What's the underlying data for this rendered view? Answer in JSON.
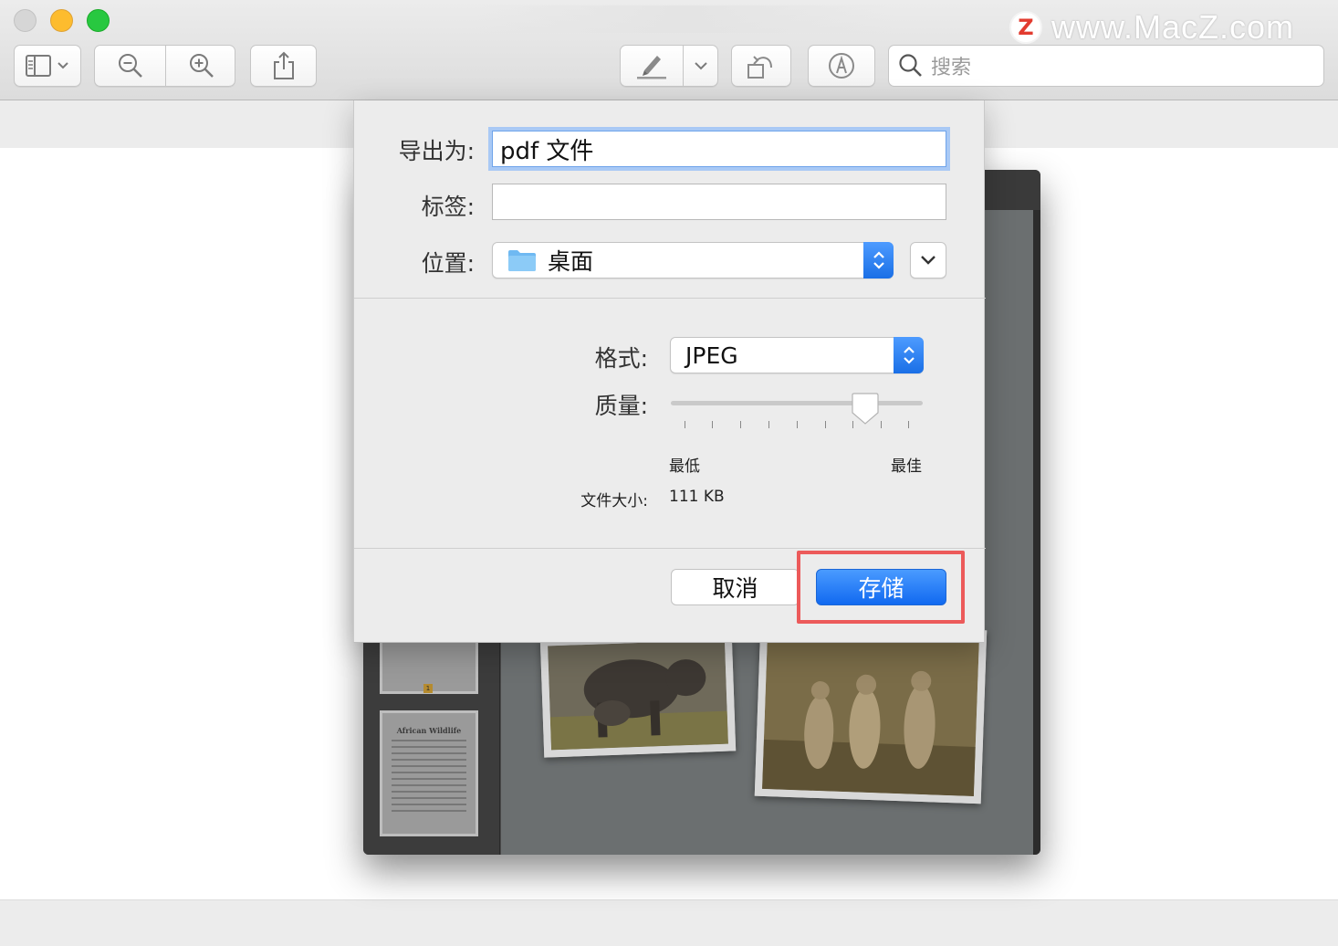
{
  "toolbar": {
    "search_placeholder": "搜索"
  },
  "watermark": {
    "logo_letter": "Z",
    "text": "www.MacZ.com"
  },
  "preview": {
    "thumb_title": "African Wildlife",
    "page_number": "1"
  },
  "save_sheet": {
    "export_as_label": "导出为:",
    "export_as_value": "pdf 文件",
    "tags_label": "标签:",
    "tags_value": "",
    "location_label": "位置:",
    "location_value": "桌面",
    "format_label": "格式:",
    "format_value": "JPEG",
    "quality_label": "质量:",
    "quality_min_label": "最低",
    "quality_max_label": "最佳",
    "quality_level": 0.77,
    "file_size_label": "文件大小:",
    "file_size_value": "111 KB",
    "cancel_label": "取消",
    "save_label": "存储"
  },
  "colors": {
    "accent": "#1a6fe6",
    "highlight": "#ec5a5a"
  }
}
